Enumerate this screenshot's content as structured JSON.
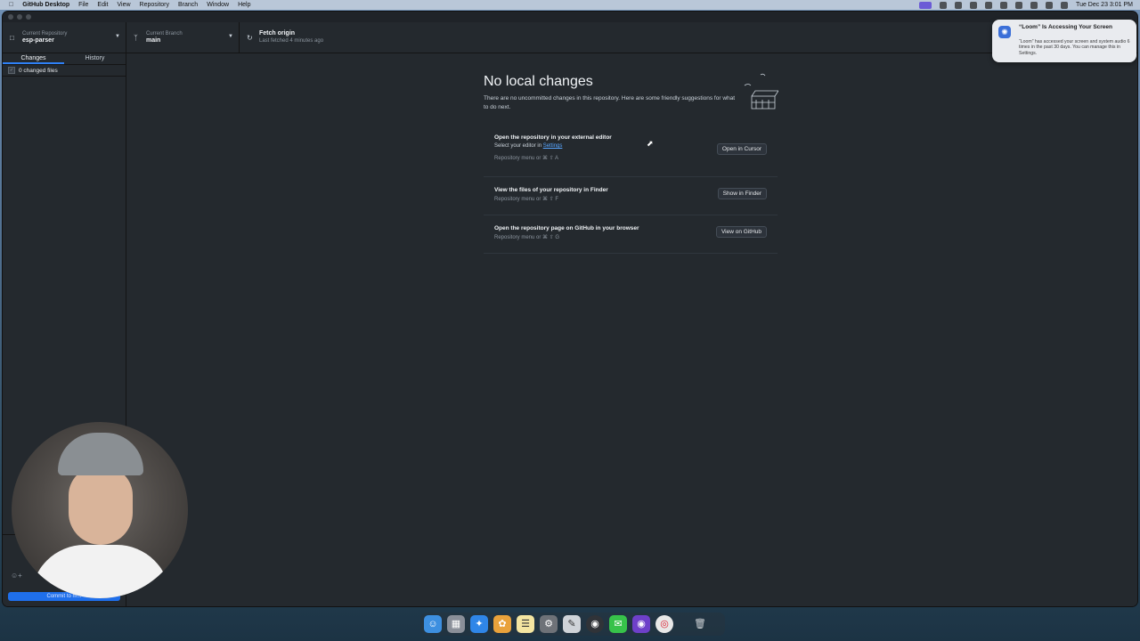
{
  "menubar": {
    "apple": "",
    "app_name": "GitHub Desktop",
    "menus": [
      "File",
      "Edit",
      "View",
      "Repository",
      "Branch",
      "Window",
      "Help"
    ],
    "datetime": "Tue Dec 23  3:01 PM"
  },
  "toolbar": {
    "repo_label": "Current Repository",
    "repo_name": "esp-parser",
    "branch_label": "Current Branch",
    "branch_name": "main",
    "fetch_label": "Fetch origin",
    "fetch_sub": "Last fetched 4 minutes ago"
  },
  "sidebar": {
    "tabs": [
      "Changes",
      "History"
    ],
    "changed_files": "0 changed files",
    "commit_button": "Commit to m..."
  },
  "blank_slate": {
    "title": "No local changes",
    "description": "There are no uncommitted changes in this repository. Here are some friendly suggestions for what to do next.",
    "actions": [
      {
        "title": "Open the repository in your external editor",
        "subtitle_prefix": "Select your editor in ",
        "subtitle_link": "Settings",
        "shortcut": "Repository menu or  ⌘  ⇧  A",
        "button": "Open in Cursor"
      },
      {
        "title": "View the files of your repository in Finder",
        "shortcut": "Repository menu or  ⌘  ⇧  F",
        "button": "Show in Finder"
      },
      {
        "title": "Open the repository page on GitHub in your browser",
        "shortcut": "Repository menu or  ⌘  ⇧  G",
        "button": "View on GitHub"
      }
    ]
  },
  "notification": {
    "title": "“Loom” Is Accessing Your Screen",
    "body": "“Loom” has accessed your screen and system audio 6 times in the past 30 days. You can manage this in Settings."
  },
  "dock": {
    "icons": [
      "finder-icon",
      "launchpad-icon",
      "safari-icon",
      "photos-icon",
      "notes-icon",
      "system-settings-icon",
      "scripts-icon",
      "obs-icon",
      "messages-icon",
      "github-desktop-icon",
      "chrome-icon",
      "trash-icon"
    ]
  },
  "colors": {
    "window_bg": "#24292e",
    "accent_blue": "#1f6feb",
    "link_blue": "#58a6ff"
  }
}
